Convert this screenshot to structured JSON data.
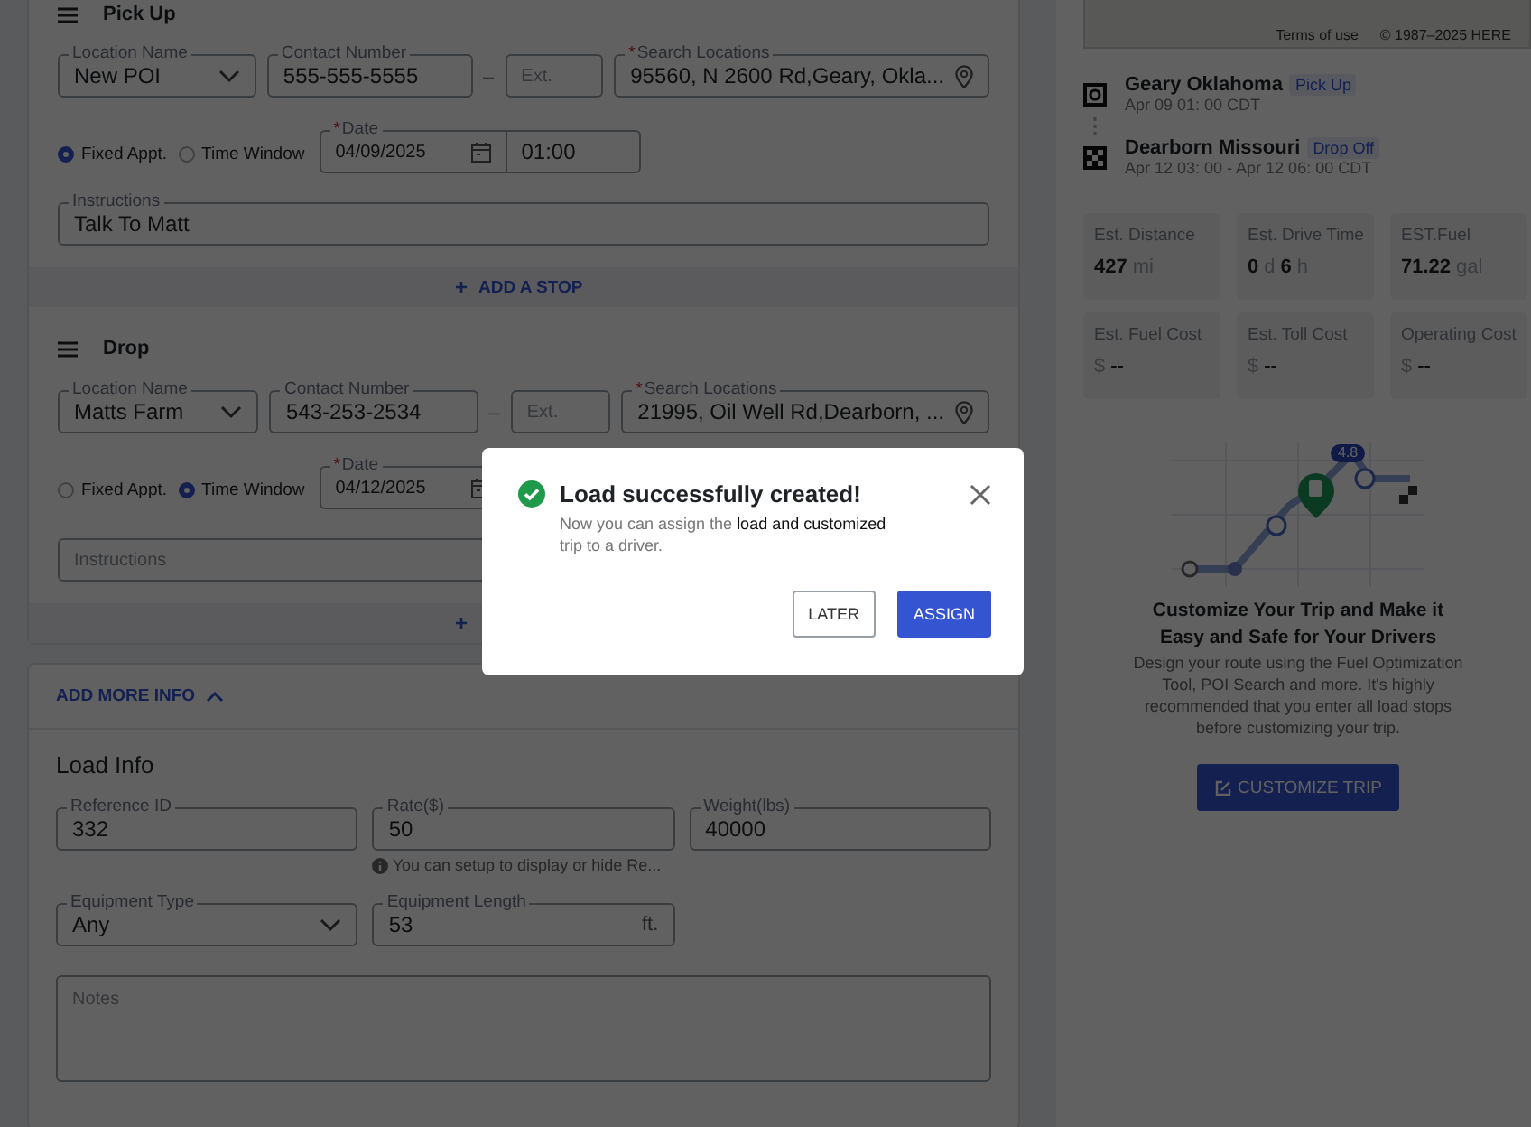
{
  "stops": [
    {
      "title": "Pick Up",
      "location_name": {
        "label": "Location Name",
        "value": "New POI"
      },
      "contact": {
        "label": "Contact Number",
        "value": "555-555-5555"
      },
      "separator": "–",
      "ext": {
        "placeholder": "Ext."
      },
      "search": {
        "label": "Search Locations",
        "required_mark": "*",
        "value": "95560, N 2600 Rd,Geary, Okla..."
      },
      "appointment": [
        {
          "label": "Fixed Appt.",
          "selected": true
        },
        {
          "label": "Time Window",
          "selected": false
        }
      ],
      "date": {
        "label": "Date",
        "required_mark": "*",
        "value": "04/09/2025"
      },
      "time": {
        "value": "01:00"
      },
      "instructions": {
        "label": "Instructions",
        "value": "Talk To Matt"
      },
      "add_stop": {
        "icon": "+",
        "label": "ADD A STOP"
      }
    },
    {
      "title": "Drop",
      "location_name": {
        "label": "Location Name",
        "value": "Matts Farm"
      },
      "contact": {
        "label": "Contact Number",
        "value": "543-253-2534"
      },
      "separator": "–",
      "ext": {
        "placeholder": "Ext."
      },
      "search": {
        "label": "Search Locations",
        "required_mark": "*",
        "value": "21995, Oil Well Rd,Dearborn, ..."
      },
      "appointment": [
        {
          "label": "Fixed Appt.",
          "selected": false
        },
        {
          "label": "Time Window",
          "selected": true
        }
      ],
      "date": {
        "label": "Date",
        "required_mark": "*",
        "value": "04/12/2025"
      },
      "instructions": {
        "placeholder": "Instructions"
      },
      "add_stop": {
        "icon": "+"
      }
    }
  ],
  "more_info": {
    "toggle": "ADD MORE INFO",
    "expanded": true,
    "section_title": "Load Info",
    "rows": [
      [
        {
          "kind": "text",
          "label": "Reference ID",
          "value": "332"
        },
        {
          "kind": "text",
          "label": "Rate($)",
          "value": "50",
          "hint": "You can setup to display or hide Re..."
        },
        {
          "kind": "text",
          "label": "Weight(lbs)",
          "value": "40000"
        }
      ],
      [
        {
          "kind": "select",
          "label": "Equipment Type",
          "value": "Any"
        },
        {
          "kind": "text",
          "label": "Equipment Length",
          "value": "53",
          "unit": "ft."
        }
      ],
      [
        {
          "kind": "textarea",
          "placeholder": "Notes"
        }
      ]
    ]
  },
  "map": {
    "terms": "Terms of use",
    "copyright": "© 1987–2025 HERE"
  },
  "route": [
    {
      "kind": "pickup",
      "name": "Geary Oklahoma",
      "tag": "Pick Up",
      "time": "Apr 09 01: 00 CDT"
    },
    {
      "kind": "drop",
      "name": "Dearborn Missouri",
      "tag": "Drop Off",
      "time": "Apr 12 03: 00 - Apr 12 06: 00 CDT"
    }
  ],
  "stats": [
    {
      "label": "Est. Distance",
      "parts": [
        {
          "text": "427",
          "strong": true
        },
        {
          "text": "mi",
          "strong": false
        }
      ]
    },
    {
      "label": "Est. Drive Time",
      "parts": [
        {
          "text": "0",
          "strong": true
        },
        {
          "text": "d",
          "strong": false
        },
        {
          "text": "6",
          "strong": true
        },
        {
          "text": "h",
          "strong": false
        }
      ]
    },
    {
      "label": "EST.Fuel",
      "parts": [
        {
          "text": "71.22",
          "strong": true
        },
        {
          "text": "gal",
          "strong": false
        }
      ]
    },
    {
      "label": "Est. Fuel Cost",
      "parts": [
        {
          "text": "$",
          "strong": false
        },
        {
          "text": "--",
          "strong": true
        }
      ]
    },
    {
      "label": "Est. Toll Cost",
      "parts": [
        {
          "text": "$",
          "strong": false
        },
        {
          "text": "--",
          "strong": true
        }
      ]
    },
    {
      "label": "Operating Cost",
      "parts": [
        {
          "text": "$",
          "strong": false
        },
        {
          "text": "--",
          "strong": true
        }
      ]
    }
  ],
  "promo": {
    "badge": "4.8",
    "title": "Customize Your Trip and Make it Easy and Safe for Your Drivers",
    "text": "Design your route using the Fuel Optimization Tool, POI Search and more. It's highly recommended that you enter all load stops before customizing your trip.",
    "button": "CUSTOMIZE TRIP"
  },
  "modal": {
    "title": "Load successfully created!",
    "message": "Now you can assign the **load and customized** trip to a driver.",
    "buttons": [
      {
        "label": "LATER",
        "kind": "secondary"
      },
      {
        "label": "ASSIGN",
        "kind": "primary"
      }
    ]
  }
}
